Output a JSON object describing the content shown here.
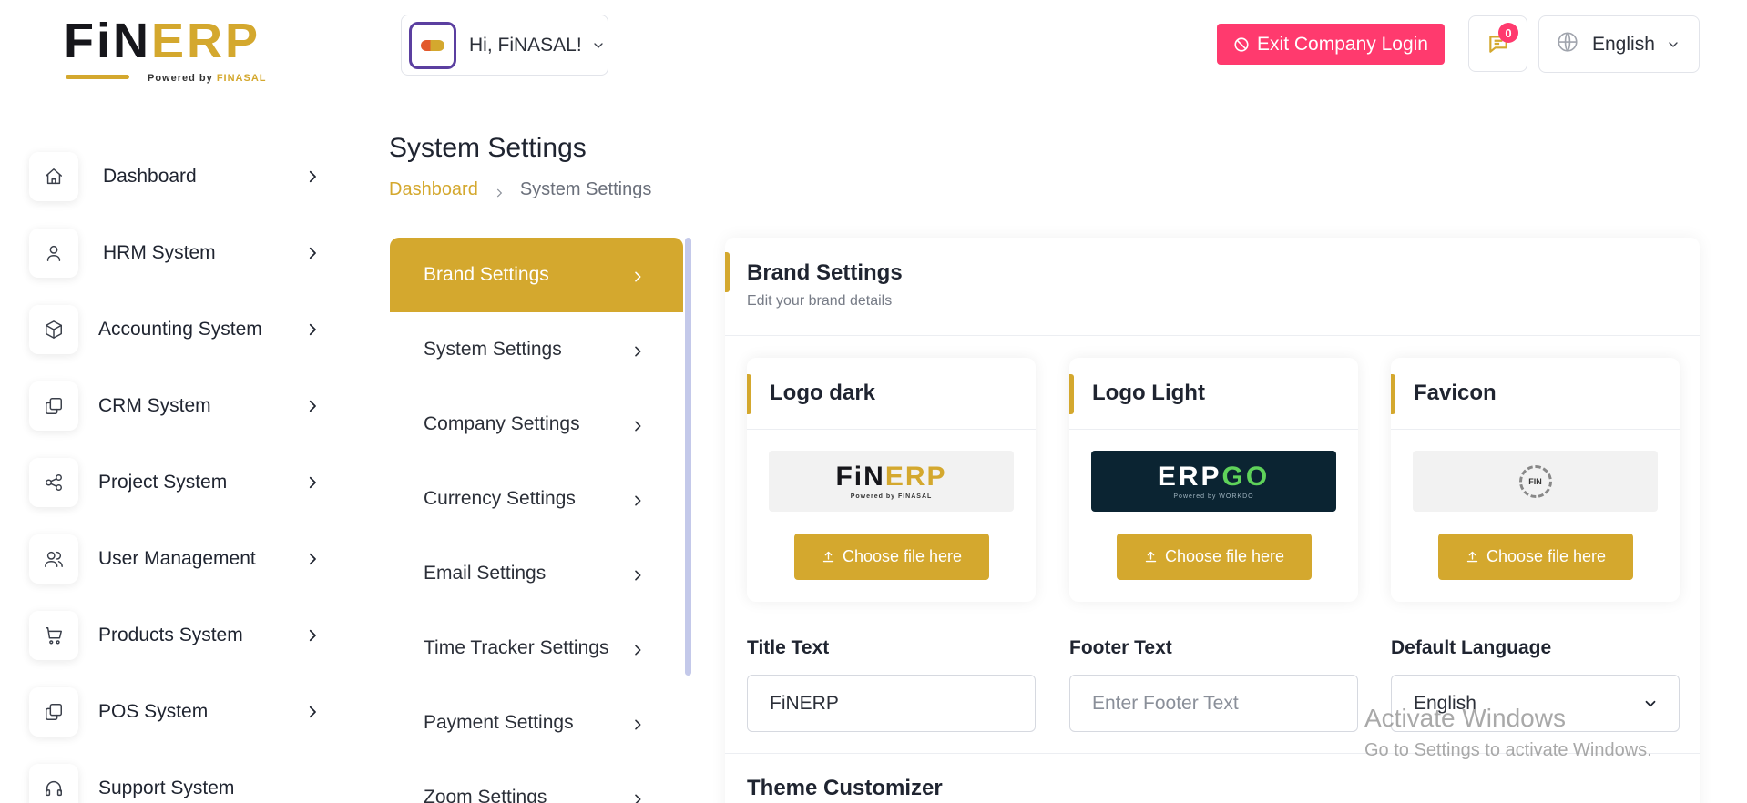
{
  "brand": {
    "logo_dark_part": "FiN",
    "logo_gold_part": "ERP",
    "powered_by": "Powered by",
    "powered_brand": "FINASAL"
  },
  "sidebar": {
    "items": [
      {
        "label": "Dashboard",
        "icon": "home-icon",
        "chevron": true
      },
      {
        "label": "HRM System",
        "icon": "user-icon",
        "chevron": true
      },
      {
        "label": "Accounting System",
        "icon": "box-icon",
        "chevron": true
      },
      {
        "label": "CRM System",
        "icon": "layers-icon",
        "chevron": true
      },
      {
        "label": "Project System",
        "icon": "share-icon",
        "chevron": true
      },
      {
        "label": "User Management",
        "icon": "users-icon",
        "chevron": true
      },
      {
        "label": "Products System",
        "icon": "cart-icon",
        "chevron": true
      },
      {
        "label": "POS System",
        "icon": "layers-icon",
        "chevron": true
      },
      {
        "label": "Support System",
        "icon": "headset-icon",
        "chevron": false
      }
    ]
  },
  "header": {
    "greeting": "Hi, FiNASAL!",
    "exit_label": "Exit Company Login",
    "notification_count": "0",
    "language": "English"
  },
  "page": {
    "title": "System Settings",
    "breadcrumb": {
      "home": "Dashboard",
      "current": "System Settings"
    }
  },
  "settings_menu": {
    "items": [
      {
        "label": "Brand Settings",
        "active": true
      },
      {
        "label": "System Settings"
      },
      {
        "label": "Company Settings"
      },
      {
        "label": "Currency Settings"
      },
      {
        "label": "Email Settings"
      },
      {
        "label": "Time Tracker Settings"
      },
      {
        "label": "Payment Settings"
      },
      {
        "label": "Zoom Settings"
      }
    ]
  },
  "brand_settings": {
    "title": "Brand Settings",
    "subtitle": "Edit your brand details",
    "logos": [
      {
        "title": "Logo dark",
        "button": "Choose file here",
        "preview": {
          "a": "FiN",
          "b": "ERP",
          "sub": "Powered by FINASAL"
        }
      },
      {
        "title": "Logo Light",
        "button": "Choose file here",
        "preview": {
          "a": "ERP",
          "b": "GO",
          "sub": "Powered by WORKDO"
        }
      },
      {
        "title": "Favicon",
        "button": "Choose file here",
        "preview": {
          "a": "FIN"
        }
      }
    ],
    "fields": {
      "title_text_label": "Title Text",
      "title_text_value": "FiNERP",
      "footer_text_label": "Footer Text",
      "footer_text_placeholder": "Enter Footer Text",
      "default_language_label": "Default Language",
      "default_language_value": "English"
    },
    "theme_title": "Theme Customizer"
  },
  "watermark": {
    "line1": "Activate Windows",
    "line2": "Go to Settings to activate Windows."
  },
  "colors": {
    "accent": "#d4a82e",
    "danger": "#ff3a6e",
    "scrollbar": "#c4c9ea"
  }
}
